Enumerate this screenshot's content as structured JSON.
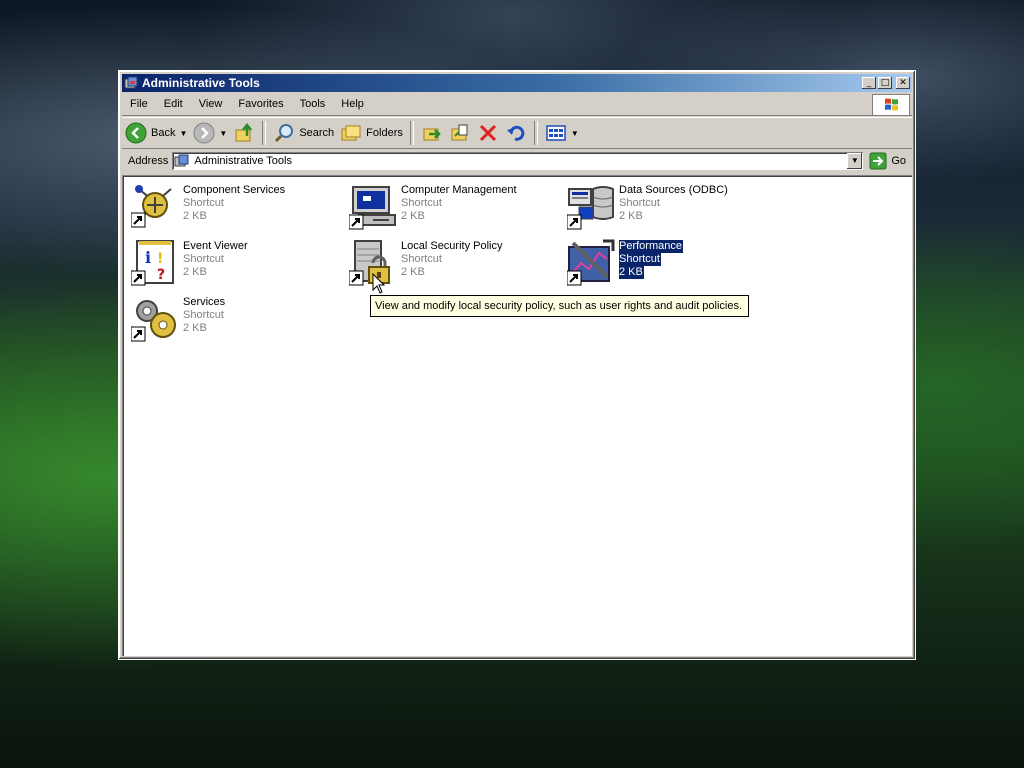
{
  "window": {
    "title": "Administrative Tools",
    "caption_min": "_",
    "caption_max": "□",
    "caption_close": "✕"
  },
  "menu": [
    "File",
    "Edit",
    "View",
    "Favorites",
    "Tools",
    "Help"
  ],
  "toolbar": {
    "back_label": "Back",
    "search_label": "Search",
    "folders_label": "Folders"
  },
  "address": {
    "label": "Address",
    "value": "Administrative Tools",
    "go_label": "Go"
  },
  "items": [
    {
      "name": "Component Services",
      "type": "Shortcut",
      "size": "2 KB",
      "icon": "component-services-icon"
    },
    {
      "name": "Computer Management",
      "type": "Shortcut",
      "size": "2 KB",
      "icon": "computer-management-icon"
    },
    {
      "name": "Data Sources (ODBC)",
      "type": "Shortcut",
      "size": "2 KB",
      "icon": "data-sources-icon"
    },
    {
      "name": "Event Viewer",
      "type": "Shortcut",
      "size": "2 KB",
      "icon": "event-viewer-icon"
    },
    {
      "name": "Local Security Policy",
      "type": "Shortcut",
      "size": "2 KB",
      "icon": "local-security-policy-icon"
    },
    {
      "name": "Performance",
      "type": "Shortcut",
      "size": "2 KB",
      "icon": "performance-icon",
      "selected": true
    },
    {
      "name": "Services",
      "type": "Shortcut",
      "size": "2 KB",
      "icon": "services-icon"
    }
  ],
  "tooltip": "View and modify local security policy, such as user rights and audit policies.",
  "colors": {
    "titlebar_start": "#0a246a",
    "titlebar_end": "#a6caf0",
    "selection": "#0a246a",
    "tooltip_bg": "#ffffe1"
  }
}
